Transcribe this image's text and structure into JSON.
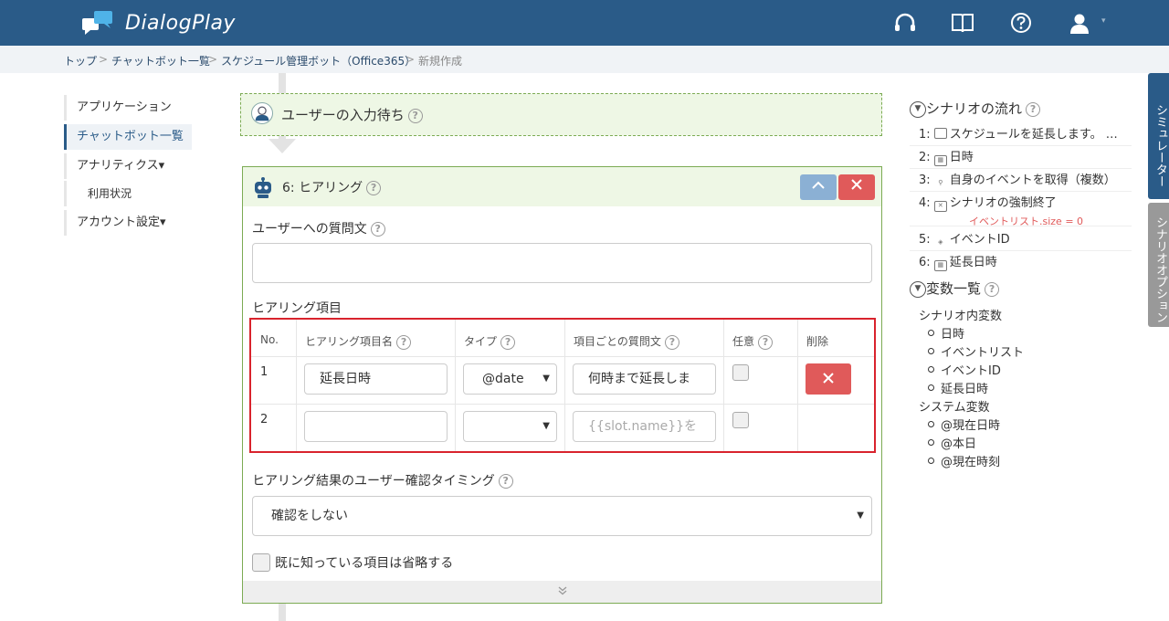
{
  "header": {
    "brand": "DialogPlay"
  },
  "breadcrumb": {
    "items": [
      "トップ",
      "チャットボット一覧",
      "スケジュール管理ボット（Office365）"
    ],
    "separator": ">",
    "current": "新規作成"
  },
  "sidebar": {
    "items": [
      {
        "label": "アプリケーション"
      },
      {
        "label": "チャットボット一覧"
      },
      {
        "label": "アナリティクス▾"
      },
      {
        "label": "利用状況"
      },
      {
        "label": "アカウント設定▾"
      }
    ]
  },
  "wait_node": {
    "title": "ユーザーの入力待ち",
    "help": "?"
  },
  "step": {
    "title": "6: ヒアリング",
    "help": "?",
    "question_label": "ユーザーへの質問文",
    "question_value": "",
    "items_label": "ヒアリング項目",
    "table": {
      "headers": [
        "No.",
        "ヒアリング項目名",
        "タイプ",
        "項目ごとの質問文",
        "任意",
        "削除"
      ],
      "rows": [
        {
          "no": "1",
          "name": "延長日時",
          "type": "@date",
          "question": "何時まで延長しま",
          "optional": false
        },
        {
          "no": "2",
          "name": "",
          "type": "",
          "question_placeholder": "{{slot.name}}を",
          "optional": false
        }
      ]
    },
    "timing_label": "ヒアリング結果のユーザー確認タイミング",
    "timing_value": "確認をしない",
    "skip_label": "既に知っている項目は省略する",
    "footer_icon": "double-chevron-down-icon"
  },
  "scenario": {
    "flow_title": "シナリオの流れ",
    "flow": [
      {
        "no": "1:",
        "icon": "speech-bubble-icon",
        "label": "スケジュールを延長します。 …"
      },
      {
        "no": "2:",
        "icon": "calendar-icon",
        "label": "日時"
      },
      {
        "no": "3:",
        "icon": "link-icon",
        "label": "自身のイベントを取得（複数）"
      },
      {
        "no": "4:",
        "icon": "terminate-icon",
        "label": "シナリオの強制終了",
        "sub": "イベントリスト.size = 0"
      },
      {
        "no": "5:",
        "icon": "tag-icon",
        "label": "イベントID"
      },
      {
        "no": "6:",
        "icon": "calendar-icon",
        "label": "延長日時"
      }
    ],
    "vars_title": "変数一覧",
    "scenario_vars_label": "シナリオ内変数",
    "scenario_vars": [
      "日時",
      "イベントリスト",
      "イベントID",
      "延長日時"
    ],
    "system_vars_label": "システム変数",
    "system_vars": [
      "@現在日時",
      "@本日",
      "@現在時刻"
    ]
  },
  "side_tabs": {
    "simulator": "シミュレーター",
    "options": "シナリオオプション"
  },
  "colors": {
    "header": "#2a5b88",
    "accent_green": "#7cab54",
    "danger": "#e05a5a",
    "highlight_border": "#d9232d"
  }
}
